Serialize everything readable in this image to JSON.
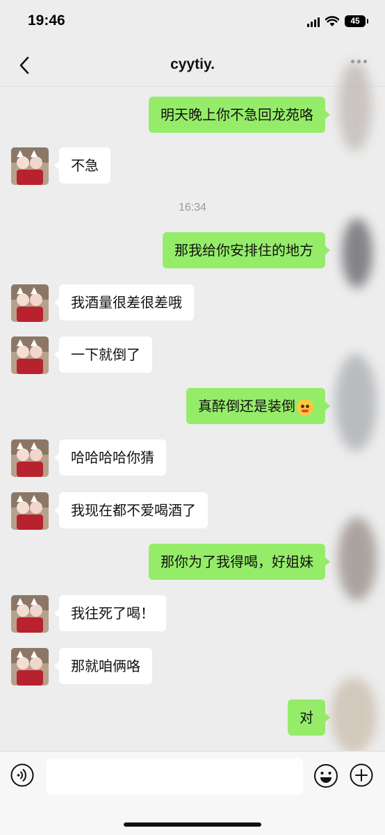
{
  "status_bar": {
    "time": "19:46",
    "battery": "45"
  },
  "header": {
    "title": "cyytiy."
  },
  "messages": [
    {
      "side": "out",
      "text": "明天晚上你不急回龙苑咯"
    },
    {
      "side": "in",
      "text": "不急"
    },
    {
      "type": "time",
      "text": "16:34"
    },
    {
      "side": "out",
      "text": "那我给你安排住的地方"
    },
    {
      "side": "in",
      "text": "我酒量很差很差哦"
    },
    {
      "side": "in",
      "text": "一下就倒了"
    },
    {
      "side": "out",
      "text": "真醉倒还是装倒",
      "emoji": "woozy-face"
    },
    {
      "side": "in",
      "text": "哈哈哈哈你猜"
    },
    {
      "side": "in",
      "text": "我现在都不爱喝酒了"
    },
    {
      "side": "out",
      "text": "那你为了我得喝，好姐妹"
    },
    {
      "side": "in",
      "text": "我往死了喝！"
    },
    {
      "side": "in",
      "text": "那就咱俩咯"
    },
    {
      "side": "out",
      "text": "对"
    }
  ],
  "input_bar": {
    "value": ""
  },
  "colors": {
    "outgoing_bubble": "#95ec69",
    "incoming_bubble": "#ffffff",
    "background": "#ededed"
  },
  "icons": [
    "back-icon",
    "more-icon",
    "voice-icon",
    "emoji-icon",
    "plus-icon",
    "wifi-icon",
    "signal-icon",
    "battery-icon"
  ]
}
